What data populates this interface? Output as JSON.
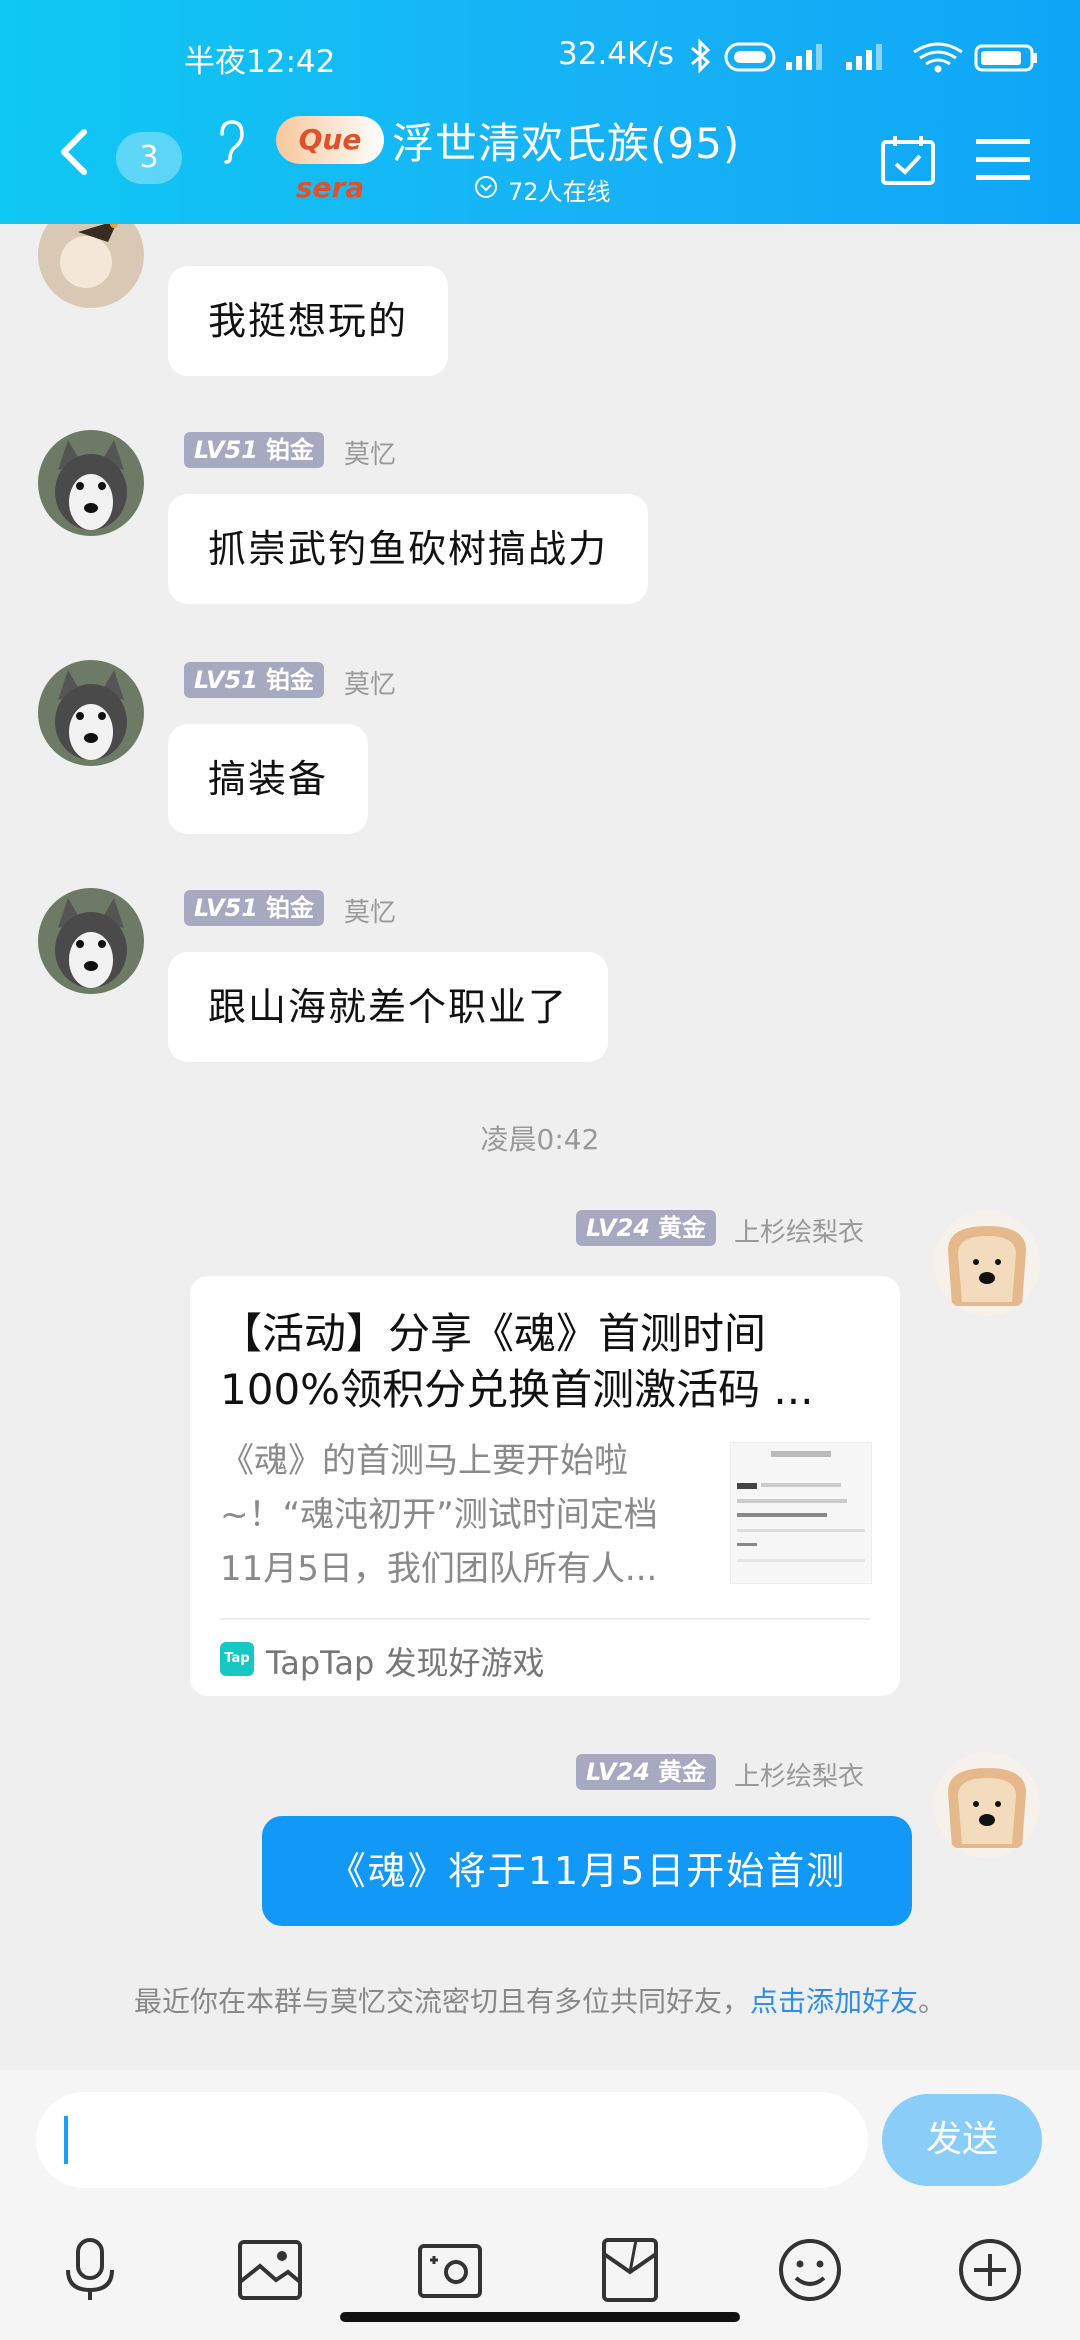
{
  "status_bar": {
    "time": "半夜12:42",
    "network_speed": "32.4K/s"
  },
  "header": {
    "unread_count": "3",
    "logo_text": "Que sera",
    "title": "浮世清欢氏族(95)",
    "online_text": "72人在线"
  },
  "messages": [
    {
      "text": "我挺想玩的"
    },
    {
      "level": "LV51",
      "rank": "铂金",
      "nickname": "莫忆",
      "text": "抓崇武钓鱼砍树搞战力"
    },
    {
      "level": "LV51",
      "rank": "铂金",
      "nickname": "莫忆",
      "text": "搞装备"
    },
    {
      "level": "LV51",
      "rank": "铂金",
      "nickname": "莫忆",
      "text": "跟山海就差个职业了"
    }
  ],
  "timestamp": "凌晨0:42",
  "share_message": {
    "level": "LV24",
    "rank": "黄金",
    "nickname": "上杉绘梨衣",
    "card_title": "【活动】分享《魂》首测时间100%领积分兑换首测激活码 ...",
    "card_desc": "《魂》的首测马上要开始啦~！“魂沌初开”测试时间定档11月5日，我们团队所有人...",
    "card_source_icon": "Tap",
    "card_source": "TapTap 发现好游戏"
  },
  "text_message": {
    "level": "LV24",
    "rank": "黄金",
    "nickname": "上杉绘梨衣",
    "text": "《魂》将于11月5日开始首测"
  },
  "system_message": {
    "text": "最近你在本群与莫忆交流密切且有多位共同好友，",
    "link": "点击添加好友",
    "suffix": "。"
  },
  "input": {
    "send_label": "发送"
  },
  "toolbar": [
    "microphone-icon",
    "picture-icon",
    "camera-icon",
    "red-packet-icon",
    "emoji-icon",
    "plus-icon"
  ],
  "colors": {
    "header": "#17b2f6",
    "blue_bubble": "#1298f7",
    "send_button": "#8bcdf9",
    "level_tag": "#a6a9c0",
    "link": "#2f8ee8"
  }
}
